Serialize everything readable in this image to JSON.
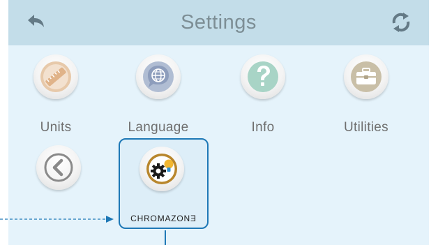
{
  "header": {
    "title": "Settings",
    "back_icon": "back-arrow-icon",
    "refresh_icon": "refresh-icon"
  },
  "tiles": [
    {
      "label": "Units",
      "icon": "ruler-icon"
    },
    {
      "label": "Language",
      "icon": "globe-speech-icon"
    },
    {
      "label": "Info",
      "icon": "question-icon"
    },
    {
      "label": "Utilities",
      "icon": "toolbox-icon"
    }
  ],
  "row2": {
    "prev_icon": "chevron-left-icon",
    "chromazone": {
      "label": "CHROMAZONƎ",
      "icon": "gear-bulb-icon"
    }
  },
  "colors": {
    "header_bg": "#c3dde9",
    "screen_bg": "#e5f3fb",
    "highlight_border": "#1e78b6",
    "units": "#e7c9aa",
    "language": "#b0bdd3",
    "info": "#a8d4c6",
    "utilities": "#c9bfa7",
    "chromazone_ring": "#b8862c"
  }
}
